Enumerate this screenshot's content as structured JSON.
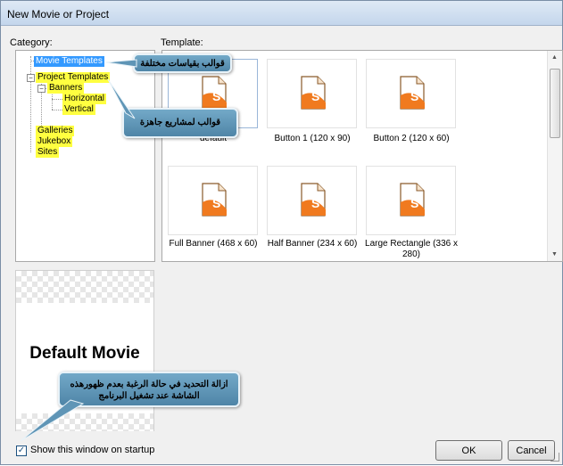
{
  "window": {
    "title": "New Movie or Project"
  },
  "labels": {
    "category": "Category:",
    "template": "Template:"
  },
  "tree": {
    "items": [
      {
        "label": "Movie Templates"
      },
      {
        "label": "Project Templates"
      },
      {
        "label": "Banners"
      },
      {
        "label": "Horizontal"
      },
      {
        "label": "Vertical"
      },
      {
        "label": "Galleries"
      },
      {
        "label": "Jukebox"
      },
      {
        "label": "Sites"
      }
    ]
  },
  "templates": [
    {
      "label": "default"
    },
    {
      "label": "Button 1 (120 x 90)"
    },
    {
      "label": "Button 2 (120 x 60)"
    },
    {
      "label": "Full Banner (468 x 60)"
    },
    {
      "label": "Half Banner (234 x 60)"
    },
    {
      "label": "Large Rectangle (336 x 280)"
    }
  ],
  "preview": {
    "title": "Default Movie"
  },
  "callouts": {
    "movie_templates": "قوالب بقياسات مختلفة",
    "project_templates": "قوالب لمشاريع جاهزة",
    "startup": "ازالة التحديد في حالة الرغبة بعدم ظهورهذه الشاشة عند تشغيل البرنامج"
  },
  "startup_checkbox": {
    "label": "Show this window on startup",
    "checked": true
  },
  "buttons": {
    "ok": "OK",
    "cancel": "Cancel"
  },
  "colors": {
    "highlight": "#ffff40",
    "selection": "#3399ff",
    "callout": "#5f95b6",
    "icon_orange": "#f07a1f"
  }
}
